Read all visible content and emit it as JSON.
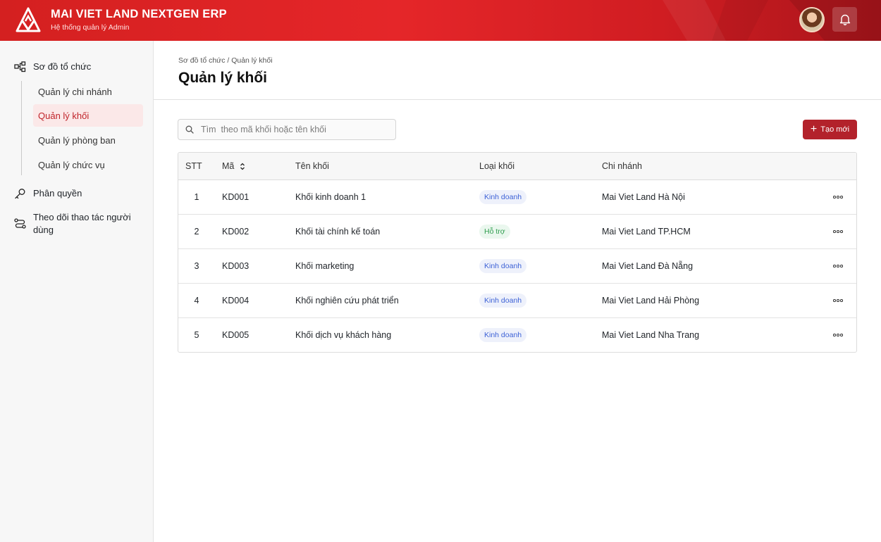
{
  "header": {
    "brand_title": "MAI VIET LAND NEXTGEN ERP",
    "brand_subtitle": "Hệ thống quản lý Admin",
    "accent_color": "#e52629"
  },
  "sidebar": {
    "groups": [
      {
        "label": "Sơ đồ tổ chức",
        "icon": "org-chart-icon",
        "items": [
          {
            "label": "Quản lý chi nhánh",
            "active": false
          },
          {
            "label": "Quản lý khối",
            "active": true
          },
          {
            "label": "Quản lý phòng ban",
            "active": false
          },
          {
            "label": "Quản lý chức vụ",
            "active": false
          }
        ]
      },
      {
        "label": "Phân quyền",
        "icon": "key-icon"
      },
      {
        "label": "Theo dõi thao tác người dùng",
        "icon": "route-icon"
      }
    ]
  },
  "main": {
    "breadcrumb": "Sơ đồ tổ chức / Quản lý khối",
    "title": "Quản lý khối",
    "search": {
      "placeholder": "Tìm  theo mã khối hoặc tên khối",
      "value": ""
    },
    "create_button": "Tạo mới",
    "table": {
      "columns": [
        "STT",
        "Mã",
        "Tên khối",
        "Loại khối",
        "Chi nhánh"
      ],
      "rows": [
        {
          "stt": "1",
          "ma": "KD001",
          "ten": "Khối kinh doanh 1",
          "loai": "Kinh doanh",
          "chi_nhanh": "Mai Viet Land Hà Nội"
        },
        {
          "stt": "2",
          "ma": "KD002",
          "ten": "Khối tài chính kế toán",
          "loai": "Hỗ trợ",
          "chi_nhanh": "Mai Viet Land TP.HCM"
        },
        {
          "stt": "3",
          "ma": "KD003",
          "ten": "Khối marketing",
          "loai": "Kinh doanh",
          "chi_nhanh": "Mai Viet Land Đà Nẵng"
        },
        {
          "stt": "4",
          "ma": "KD004",
          "ten": "Khối nghiên cứu phát triển",
          "loai": "Kinh doanh",
          "chi_nhanh": "Mai Viet Land Hải Phòng"
        },
        {
          "stt": "5",
          "ma": "KD005",
          "ten": "Khối dịch vụ khách hàng",
          "loai": "Kinh doanh",
          "chi_nhanh": "Mai Viet Land Nha Trang"
        }
      ]
    }
  }
}
